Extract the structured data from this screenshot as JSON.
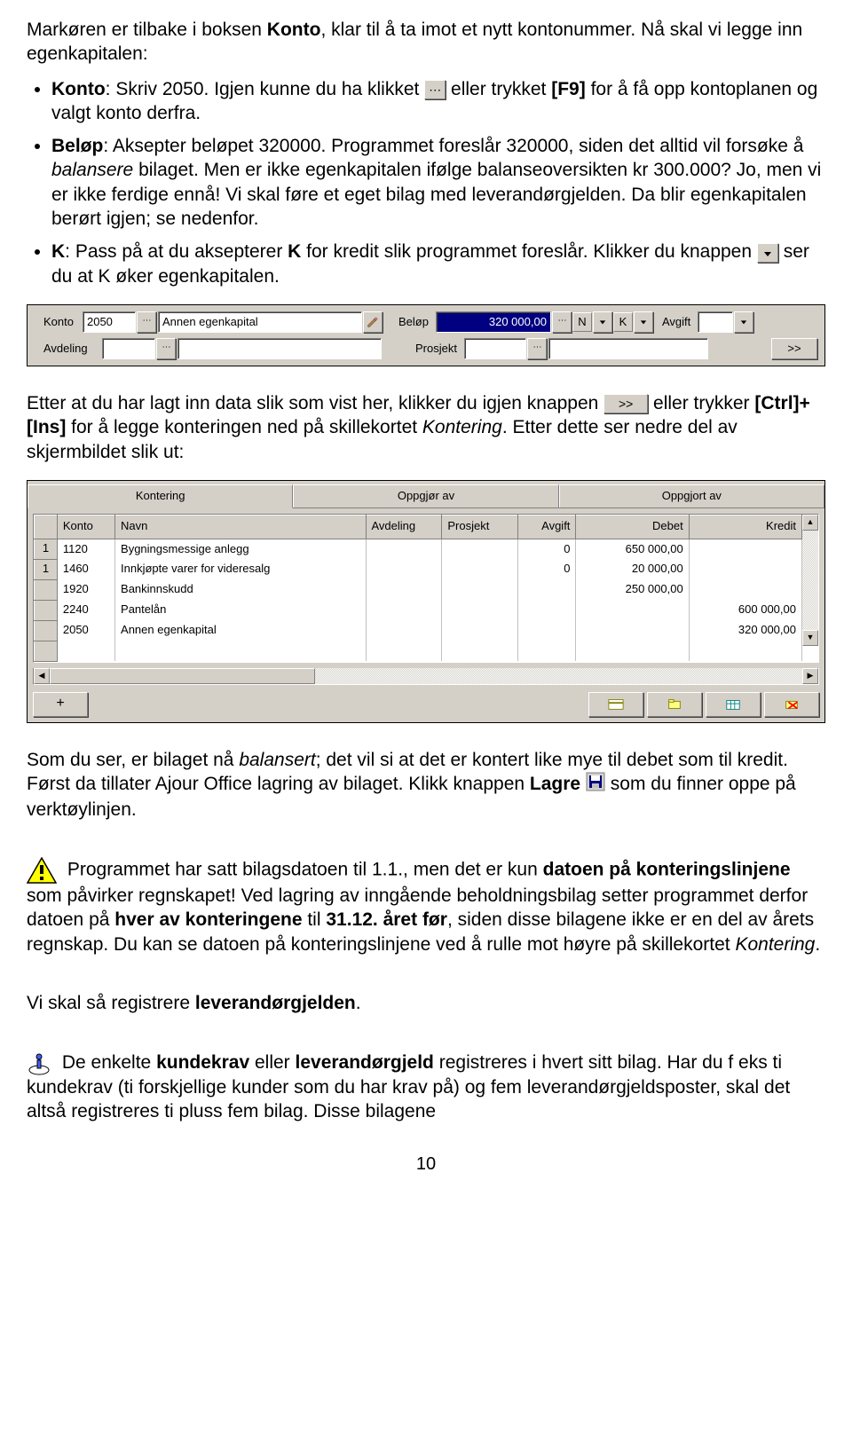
{
  "intro": {
    "p1a": "Markøren er tilbake i boksen ",
    "p1b_bold": "Konto",
    "p1c": ", klar til å ta imot et nytt kontonummer. Nå skal vi legge inn egenkapitalen:"
  },
  "bullets1": {
    "b1a_bold": "Konto",
    "b1b": ": Skriv 2050. Igjen kunne du ha klikket ",
    "b1c": " eller trykket ",
    "b1d_bold": "[F9]",
    "b1e": " for å få opp kontoplanen og valgt konto derfra.",
    "b2a_bold": "Beløp",
    "b2b": ": Aksepter beløpet 320000. Programmet foreslår 320000, siden det alltid vil forsøke å ",
    "b2c_it": "balansere",
    "b2d": " bilaget. Men er ikke egenkapitalen ifølge balanseoversikten kr 300.000? Jo, men vi er ikke ferdige ennå! Vi skal føre et eget bilag med leverandørgjelden. Da blir egenkapitalen berørt igjen; se nedenfor.",
    "b3a_bold": "K",
    "b3b": ": Pass på at du aksepterer ",
    "b3c_bold": "K",
    "b3d": " for kredit slik programmet foreslår. Klikker du knappen ",
    "b3e": " ser du at K øker egenkapitalen."
  },
  "panel1": {
    "konto_label": "Konto",
    "konto_value": "2050",
    "konto_name": "Annen egenkapital",
    "belop_label": "Beløp",
    "belop_value": "320 000,00",
    "nk_n": "N",
    "nk_k": "K",
    "avgift_label": "Avgift",
    "avdeling_label": "Avdeling",
    "prosjekt_label": "Prosjekt",
    "next_btn": ">>"
  },
  "after1": {
    "a": "Etter at du har lagt inn data slik som vist her, klikker du igjen knappen ",
    "b": " eller trykker ",
    "c_bold": "[Ctrl]+[Ins]",
    "d": " for å legge konteringen ned på skillekortet ",
    "e_it": "Kontering",
    "f": ". Etter dette ser nedre del av skjermbildet slik ut:"
  },
  "panel2": {
    "tabs": [
      "Kontering",
      "Oppgjør av",
      "Oppgjort av"
    ],
    "headers": [
      "",
      "Konto",
      "Navn",
      "Avdeling",
      "Prosjekt",
      "Avgift",
      "Debet",
      "Kredit"
    ],
    "rows": [
      {
        "rh": "1",
        "konto": "1120",
        "navn": "Bygningsmessige anlegg",
        "avd": "",
        "prosj": "",
        "avg": "0",
        "debet": "650 000,00",
        "kredit": ""
      },
      {
        "rh": "1",
        "konto": "1460",
        "navn": "Innkjøpte varer for videresalg",
        "avd": "",
        "prosj": "",
        "avg": "0",
        "debet": "20 000,00",
        "kredit": ""
      },
      {
        "rh": "",
        "konto": "1920",
        "navn": "Bankinnskudd",
        "avd": "",
        "prosj": "",
        "avg": "",
        "debet": "250 000,00",
        "kredit": ""
      },
      {
        "rh": "",
        "konto": "2240",
        "navn": "Pantelån",
        "avd": "",
        "prosj": "",
        "avg": "",
        "debet": "",
        "kredit": "600 000,00"
      },
      {
        "rh": "",
        "konto": "2050",
        "navn": "Annen egenkapital",
        "avd": "",
        "prosj": "",
        "avg": "",
        "debet": "",
        "kredit": "320 000,00"
      }
    ],
    "plus_btn": "+"
  },
  "after2": {
    "a": "Som du ser, er bilaget nå ",
    "b_it": "balansert",
    "c": "; det vil si at det er kontert like mye til debet som til kredit. Først da tillater Ajour Office lagring av bilaget. Klikk knappen ",
    "d_bold": "Lagre",
    "e": " som du finner oppe på verktøylinjen."
  },
  "warn": {
    "a": " Programmet har satt bilagsdatoen til 1.1., men det er kun ",
    "b_bold": "datoen på konteringslinjene",
    "c": " som påvirker regnskapet! Ved lagring av inngående beholdningsbilag setter programmet derfor datoen på ",
    "d_bold": "hver av konteringene",
    "e": " til ",
    "f_bold": "31.12. året før",
    "g": ", siden disse bilagene ikke er en del av årets regnskap. Du kan se datoen på konteringslinjene ved å rulle mot høyre på skillekortet ",
    "h_it": "Kontering",
    "i": "."
  },
  "lev": {
    "a": "Vi skal så registrere ",
    "b_bold": "leverandørgjelden",
    "c": "."
  },
  "info": {
    "a": " De enkelte ",
    "b_bold": "kundekrav",
    "c": " eller ",
    "d_bold": "leverandørgjeld",
    "e": " registreres i hvert sitt bilag. Har du f eks ti kundekrav (ti forskjellige kunder som du har krav på) og fem leverandørgjeldsposter, skal det altså registreres ti pluss fem bilag. Disse bilagene"
  },
  "pagenum": "10",
  "inline_next": ">>"
}
